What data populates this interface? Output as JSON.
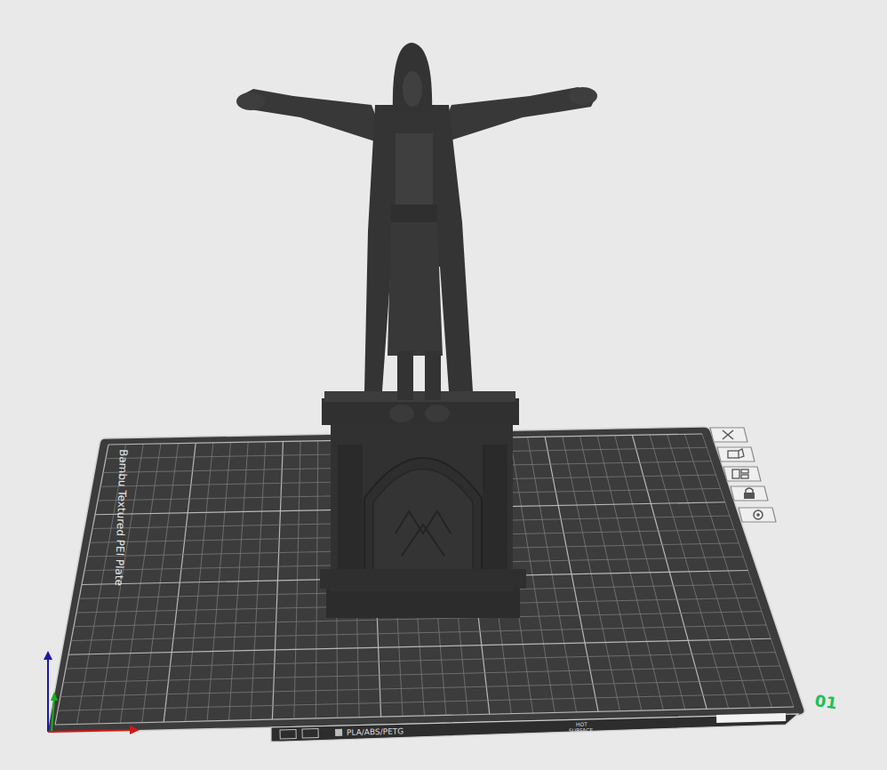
{
  "viewport": {
    "model": "statue",
    "plate": {
      "name": "Bambu Textured PEI Plate",
      "number": "01",
      "filament_label": "PLA/ABS/PETG",
      "warning_label": {
        "line1": "HOT",
        "line2": "SURFACE"
      }
    }
  }
}
